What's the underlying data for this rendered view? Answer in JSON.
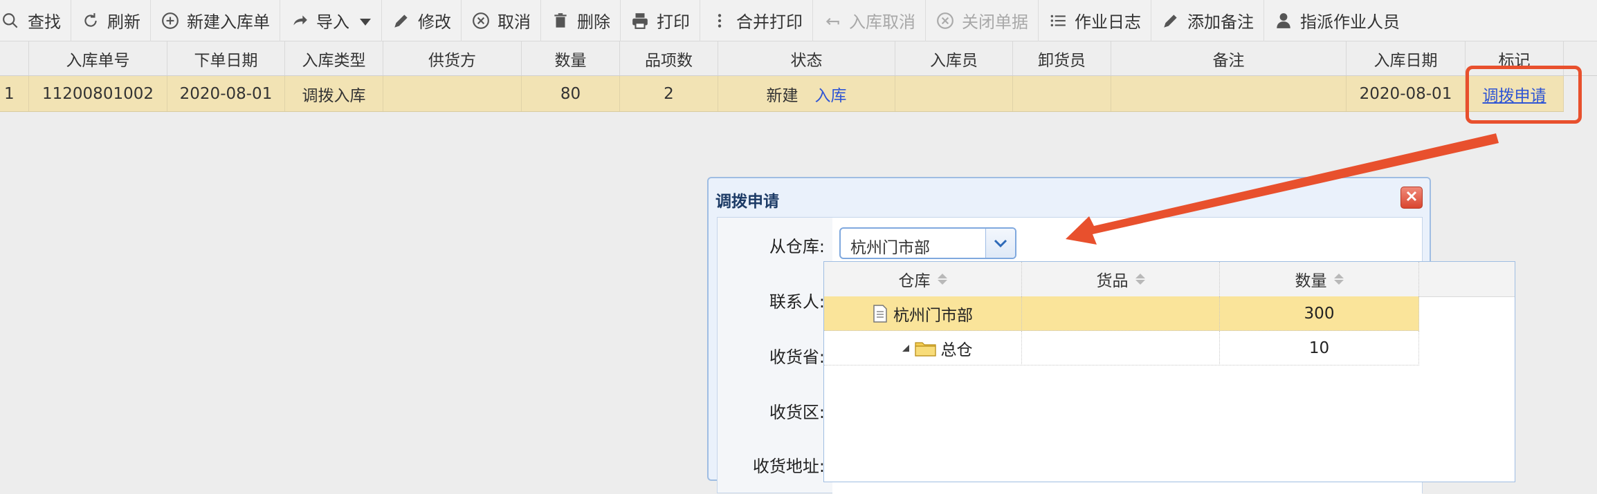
{
  "toolbar": {
    "items": [
      {
        "label": "查找",
        "icon": "search-icon",
        "disabled": false
      },
      {
        "label": "刷新",
        "icon": "refresh-icon",
        "disabled": false
      },
      {
        "label": "新建入库单",
        "icon": "plus-circle-icon",
        "disabled": false
      },
      {
        "label": "导入",
        "icon": "share-arrow-icon",
        "disabled": false
      },
      {
        "label": "修改",
        "icon": "pencil-icon",
        "disabled": false
      },
      {
        "label": "取消",
        "icon": "x-circle-icon",
        "disabled": false
      },
      {
        "label": "删除",
        "icon": "trash-icon",
        "disabled": false
      },
      {
        "label": "打印",
        "icon": "printer-icon",
        "disabled": false
      },
      {
        "label": "合并打印",
        "icon": "vertical-dots-icon",
        "disabled": false
      },
      {
        "label": "入库取消",
        "icon": "undo-arrow-icon",
        "disabled": true
      },
      {
        "label": "关闭单据",
        "icon": "x-circle-icon",
        "disabled": true
      },
      {
        "label": "作业日志",
        "icon": "list-icon",
        "disabled": false
      },
      {
        "label": "添加备注",
        "icon": "pencil-icon",
        "disabled": false
      },
      {
        "label": "指派作业人员",
        "icon": "user-icon",
        "disabled": false
      }
    ]
  },
  "grid": {
    "columns": [
      "",
      "入库单号",
      "下单日期",
      "入库类型",
      "供货方",
      "数量",
      "品项数",
      "状态",
      "入库员",
      "卸货员",
      "备注",
      "入库日期",
      "标记"
    ],
    "row": {
      "index": "1",
      "order_no": "11200801002",
      "order_date": "2020-08-01",
      "type": "调拨入库",
      "supplier": "",
      "quantity": "80",
      "item_count": "2",
      "status": "新建",
      "status_action": "入库",
      "receiver": "",
      "unloader": "",
      "remark": "",
      "in_date": "2020-08-01",
      "mark_link": "调拨申请"
    }
  },
  "dialog": {
    "title": "调拨申请",
    "labels": {
      "from_warehouse": "从仓库:",
      "contact": "联系人:",
      "province": "收货省:",
      "district": "收货区:",
      "address": "收货地址:"
    },
    "from_warehouse_value": "杭州门市部"
  },
  "dropdown": {
    "columns": [
      "仓库",
      "货品",
      "数量"
    ],
    "rows": [
      {
        "warehouse": "杭州门市部",
        "goods": "",
        "qty": "300",
        "selected": true,
        "icon": "document-icon"
      },
      {
        "warehouse": "总仓",
        "goods": "",
        "qty": "10",
        "selected": false,
        "icon": "folder-icon"
      }
    ]
  },
  "colors": {
    "accent": "#2f55d4",
    "row_highlight": "#f2e3b4",
    "annotation": "#e8502d",
    "selected_row": "#fae49a"
  }
}
